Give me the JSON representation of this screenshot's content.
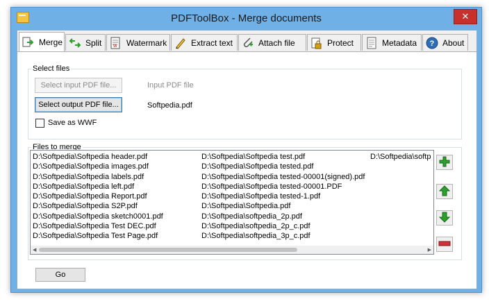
{
  "window": {
    "title": "PDFToolBox - Merge documents",
    "close_glyph": "✕"
  },
  "tabs": [
    {
      "label": "Merge",
      "icon": "merge-icon",
      "active": true
    },
    {
      "label": "Split",
      "icon": "split-icon"
    },
    {
      "label": "Watermark",
      "icon": "watermark-icon"
    },
    {
      "label": "Extract text",
      "icon": "extract-text-icon"
    },
    {
      "label": "Attach file",
      "icon": "attach-file-icon"
    },
    {
      "label": "Protect",
      "icon": "lock-icon"
    },
    {
      "label": "Metadata",
      "icon": "metadata-icon"
    },
    {
      "label": "About",
      "icon": "help-icon"
    }
  ],
  "select_files": {
    "group_label": "Select files",
    "input_button": "Select input PDF file...",
    "input_value": "Input PDF file",
    "output_button": "Select output PDF file...",
    "output_value": "Softpedia.pdf",
    "save_as_wwf_label": "Save as WWF",
    "save_as_wwf_checked": false
  },
  "files_to_merge": {
    "group_label": "Files to merge",
    "col1": [
      "D:\\Softpedia\\Softpedia header.pdf",
      "D:\\Softpedia\\Softpedia images.pdf",
      "D:\\Softpedia\\Softpedia labels.pdf",
      "D:\\Softpedia\\Softpedia left.pdf",
      "D:\\Softpedia\\Softpedia Report.pdf",
      "D:\\Softpedia\\Softpedia S2P.pdf",
      "D:\\Softpedia\\Softpedia sketch0001.pdf",
      "D:\\Softpedia\\Softpedia Test DEC.pdf",
      "D:\\Softpedia\\Softpedia Test Page.pdf"
    ],
    "col2": [
      "D:\\Softpedia\\Softpedia test.pdf",
      "D:\\Softpedia\\Softpedia tested.pdf",
      "D:\\Softpedia\\Softpedia tested-00001(signed).pdf",
      "D:\\Softpedia\\Softpedia tested-00001.PDF",
      "D:\\Softpedia\\Softpedia tested-1.pdf",
      "D:\\Softpedia\\Softpedia.pdf",
      "D:\\Softpedia\\softpedia_2p.pdf",
      "D:\\Softpedia\\softpedia_2p_c.pdf",
      "D:\\Softpedia\\softpedia_3p_c.pdf"
    ],
    "col3": [
      "D:\\Softpedia\\softp"
    ],
    "scroll_left": "◀",
    "scroll_right": "▶"
  },
  "side_buttons": [
    "add-icon",
    "move-up-icon",
    "move-down-icon",
    "remove-icon"
  ],
  "go_button": "Go",
  "colors": {
    "frame": "#6fb0e6",
    "close": "#c7302b",
    "add_green": "#2e9e2e",
    "remove_red": "#d0303a"
  }
}
